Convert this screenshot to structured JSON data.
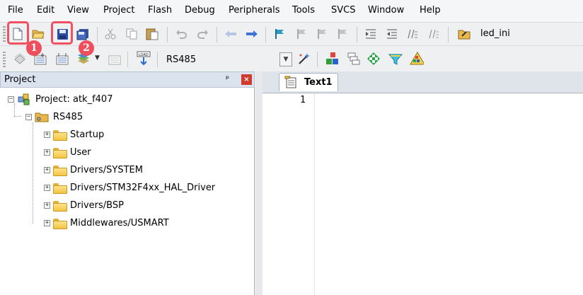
{
  "menu": [
    "File",
    "Edit",
    "View",
    "Project",
    "Flash",
    "Debug",
    "Peripherals",
    "Tools",
    "SVCS",
    "Window",
    "Help"
  ],
  "toolbar1": {
    "find_text": "led_ini",
    "icons": [
      "new-file-icon",
      "open-folder-icon",
      "save-icon",
      "save-all-icon",
      "cut-icon",
      "copy-icon",
      "paste-icon",
      "undo-icon",
      "redo-icon",
      "nav-back-icon",
      "nav-forward-icon",
      "bookmark-icon",
      "bookmark-prev-icon",
      "bookmark-next-icon",
      "bookmark-clear-icon",
      "indent-icon",
      "unindent-icon",
      "comment-icon",
      "uncomment-icon",
      "find-in-files-icon"
    ]
  },
  "toolbar2": {
    "target": "RS485",
    "icons": [
      "translate-icon",
      "build-icon",
      "rebuild-icon",
      "batch-build-icon",
      "stop-build-icon",
      "download-icon",
      "target-options-icon",
      "manage-components-icon",
      "manage-books-icon",
      "select-packs-icon",
      "pack-installer-icon",
      "event-recorder-icon"
    ]
  },
  "annotations": {
    "badge1": "1",
    "badge2": "2"
  },
  "project_panel": {
    "title": "Project",
    "pin": "ᵖ",
    "close": "×",
    "root": "Project: atk_f407",
    "target": "RS485",
    "groups": [
      "Startup",
      "User",
      "Drivers/SYSTEM",
      "Drivers/STM32F4xx_HAL_Driver",
      "Drivers/BSP",
      "Middlewares/USMART"
    ]
  },
  "editor": {
    "tab_label": "Text1",
    "line_numbers": [
      "1"
    ]
  },
  "colors": {
    "highlight": "#f0505f",
    "badge": "#ef4f5d",
    "panel_header": "#dbe3ee"
  }
}
